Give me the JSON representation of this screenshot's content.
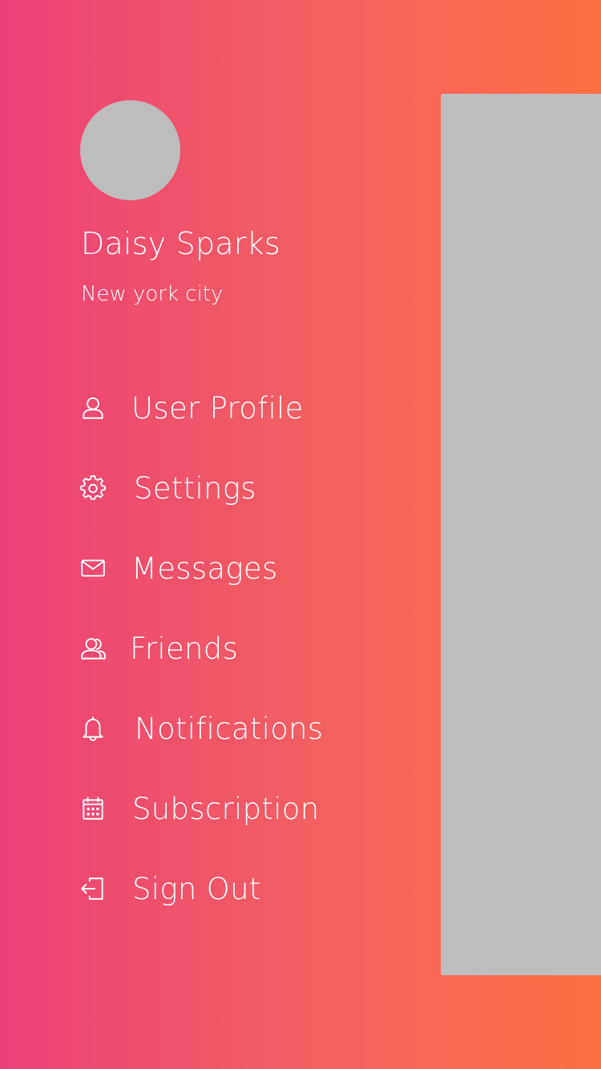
{
  "profile": {
    "name": "Daisy Sparks",
    "location": "New york city"
  },
  "menu": {
    "items": [
      {
        "label": "User Profile",
        "icon": "user-icon"
      },
      {
        "label": "Settings",
        "icon": "gear-icon"
      },
      {
        "label": "Messages",
        "icon": "mail-icon"
      },
      {
        "label": "Friends",
        "icon": "friends-icon"
      },
      {
        "label": "Notifications",
        "icon": "bell-icon"
      },
      {
        "label": "Subscription",
        "icon": "calendar-icon"
      },
      {
        "label": "Sign Out",
        "icon": "sign-out-icon"
      }
    ]
  },
  "colors": {
    "gradient_start": "#ec407a",
    "gradient_end": "#ff7043",
    "panel": "#bebebe",
    "avatar_placeholder": "#bdbdbd",
    "text": "#ffffff"
  }
}
